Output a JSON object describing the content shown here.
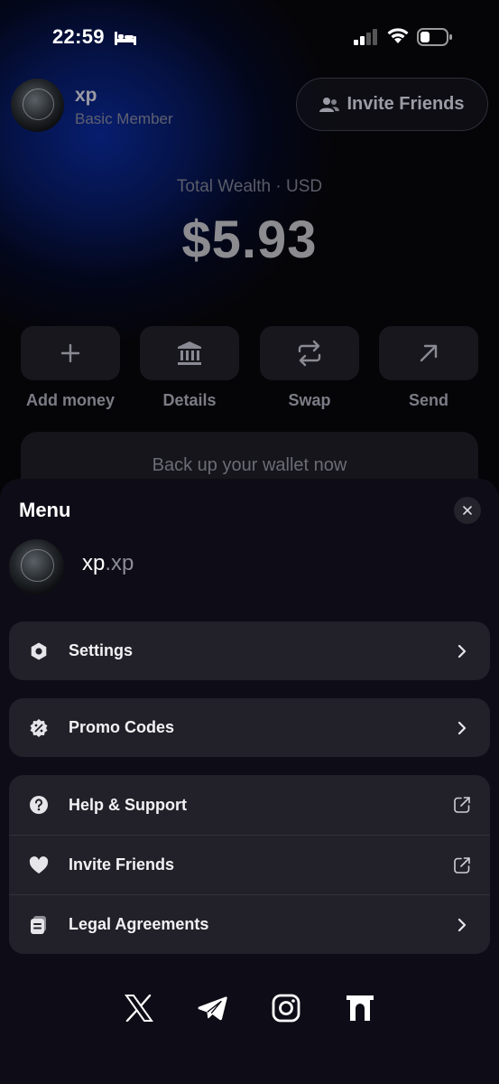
{
  "status_bar": {
    "time": "22:59"
  },
  "header": {
    "username": "xp",
    "membership": "Basic Member",
    "invite_button": "Invite Friends"
  },
  "wallet": {
    "total_label": "Total Wealth · USD",
    "total_value": "$5.93"
  },
  "actions": [
    {
      "label": "Add money",
      "icon": "plus-icon"
    },
    {
      "label": "Details",
      "icon": "bank-icon"
    },
    {
      "label": "Swap",
      "icon": "swap-icon"
    },
    {
      "label": "Send",
      "icon": "arrow-up-right-icon"
    }
  ],
  "backup_banner": "Back up your wallet now",
  "menu": {
    "title": "Menu",
    "handle_name": "xp",
    "handle_suffix": ".xp",
    "items": [
      {
        "label": "Settings",
        "icon": "settings-hexagon-icon",
        "trail": "chevron-right-icon"
      },
      {
        "label": "Promo Codes",
        "icon": "promo-badge-icon",
        "trail": "chevron-right-icon"
      },
      {
        "label": "Help & Support",
        "icon": "help-circle-icon",
        "trail": "external-link-icon"
      },
      {
        "label": "Invite Friends",
        "icon": "heart-icon",
        "trail": "external-link-icon"
      },
      {
        "label": "Legal Agreements",
        "icon": "document-icon",
        "trail": "chevron-right-icon"
      }
    ],
    "socials": [
      "x-icon",
      "telegram-icon",
      "instagram-icon",
      "gate-icon"
    ]
  }
}
